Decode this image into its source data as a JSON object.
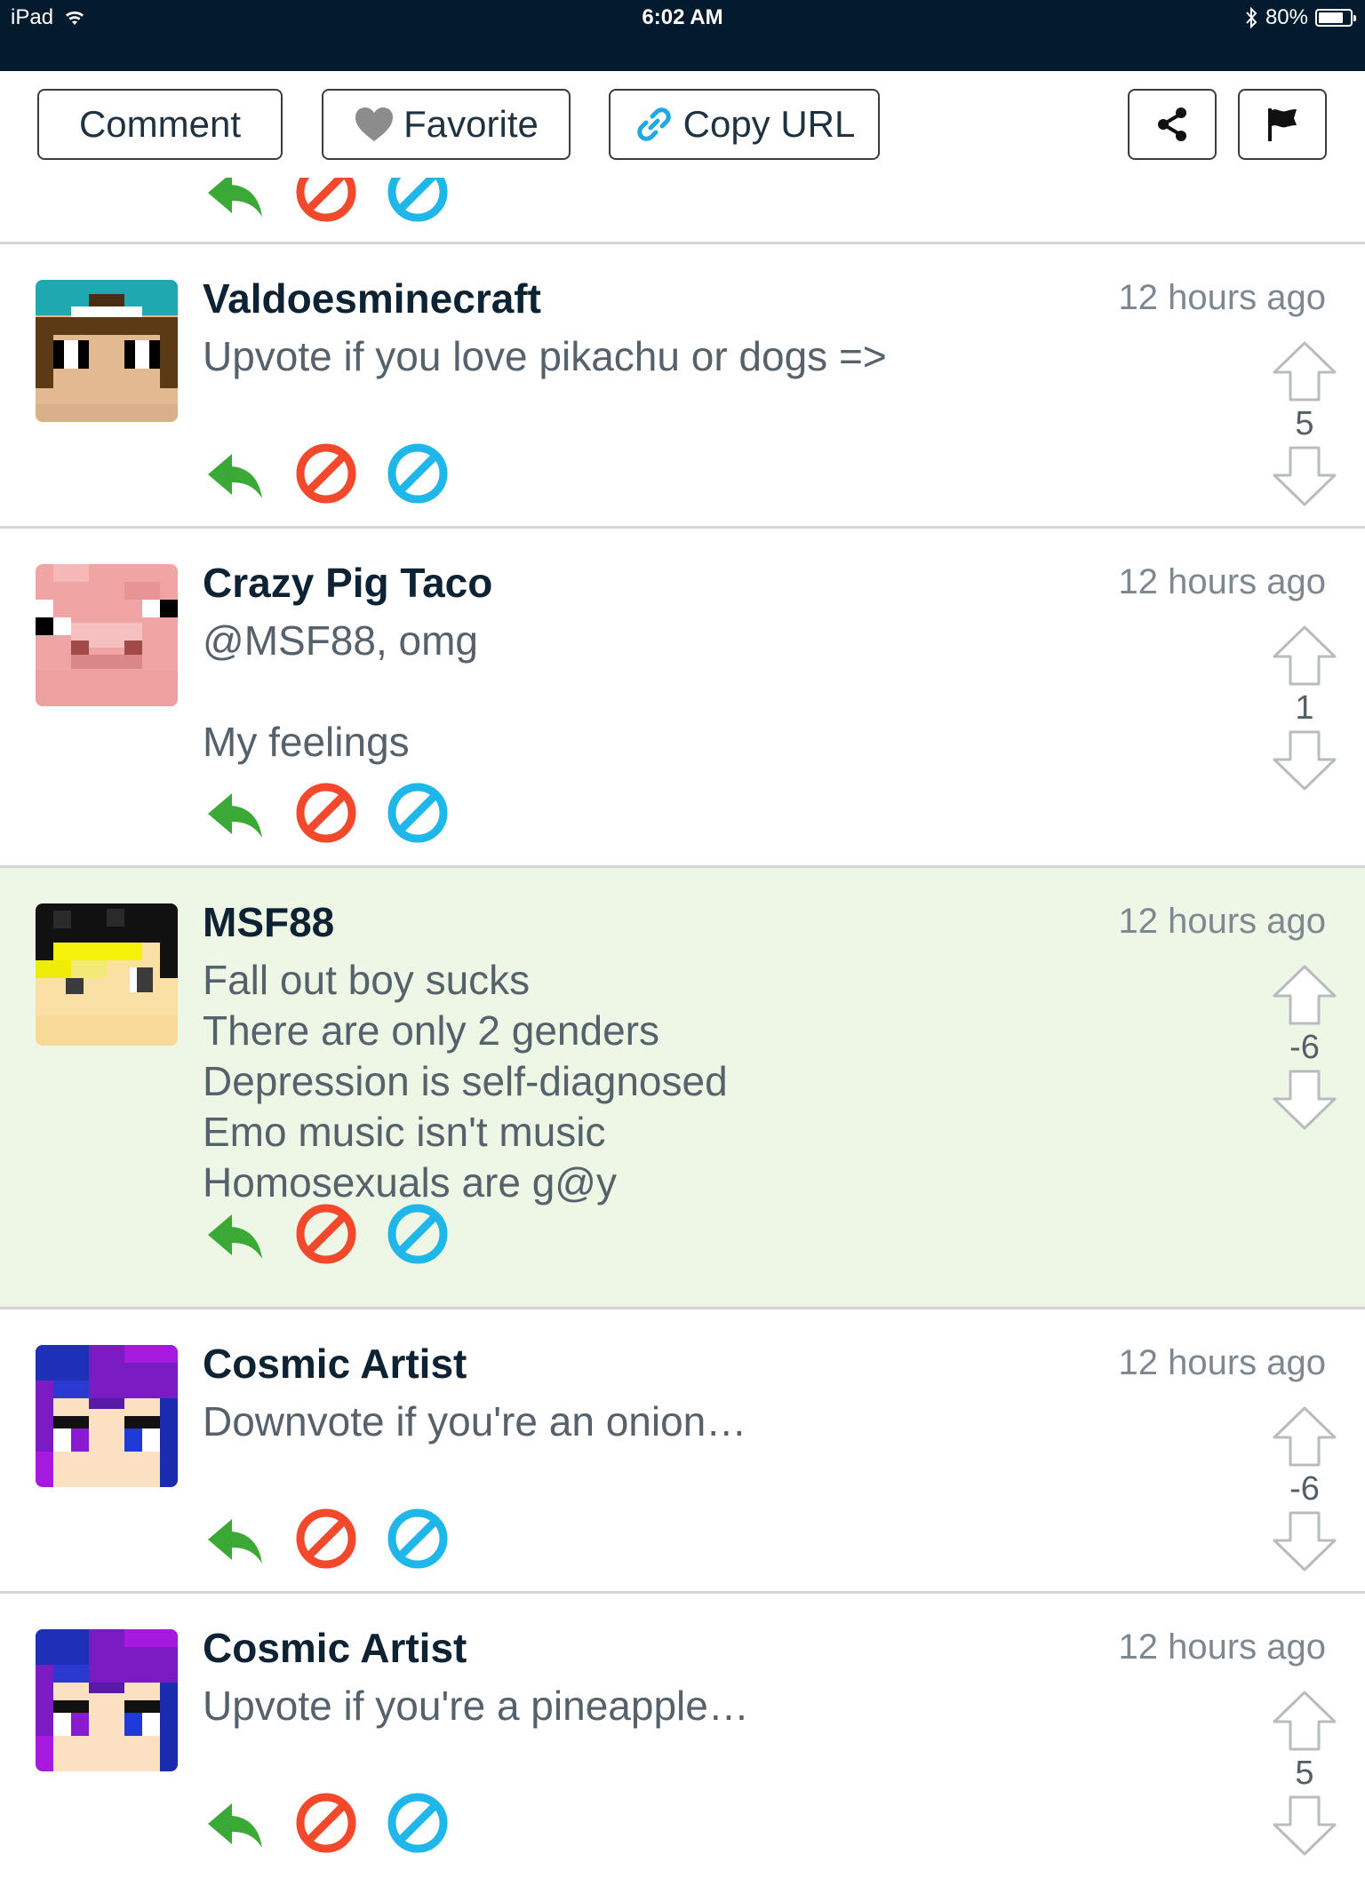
{
  "status_bar": {
    "device": "iPad",
    "time": "6:02 AM",
    "battery": "80%",
    "battery_level": 0.8
  },
  "toolbar": {
    "comment_label": "Comment",
    "favorite_label": "Favorite",
    "copy_url_label": "Copy URL"
  },
  "comments": [
    {
      "author": "Valdoesminecraft",
      "time": "12 hours ago",
      "text": "Upvote if you love pikachu or dogs =>",
      "score": "5"
    },
    {
      "author": "Crazy Pig Taco",
      "time": "12 hours ago",
      "text": "@MSF88, omg\n\nMy feelings",
      "score": "1"
    },
    {
      "author": "MSF88",
      "time": "12 hours ago",
      "text": "Fall out boy sucks\nThere are only 2 genders\nDepression is self-diagnosed\nEmo music isn't music\nHomosexuals are g@y",
      "score": "-6"
    },
    {
      "author": "Cosmic Artist",
      "time": "12 hours ago",
      "text": "Downvote if you're an onion…",
      "score": "-6"
    },
    {
      "author": "Cosmic Artist",
      "time": "12 hours ago",
      "text": "Upvote if you're a pineapple…",
      "score": "5"
    }
  ],
  "colors": {
    "status_bar": "#041b2d",
    "reply": "#3aa935",
    "block": "#f2482b",
    "ignore": "#1fb6ea",
    "highlight": "#eef7e6",
    "divider": "#d4d6d6"
  },
  "icons": {
    "reply": "reply-arrow-icon",
    "block": "block-icon",
    "ignore": "ignore-icon",
    "upvote": "upvote-arrow-icon",
    "downvote": "downvote-arrow-icon",
    "share": "share-icon",
    "flag": "flag-icon",
    "favorite": "heart-icon",
    "copy_url": "link-icon"
  }
}
